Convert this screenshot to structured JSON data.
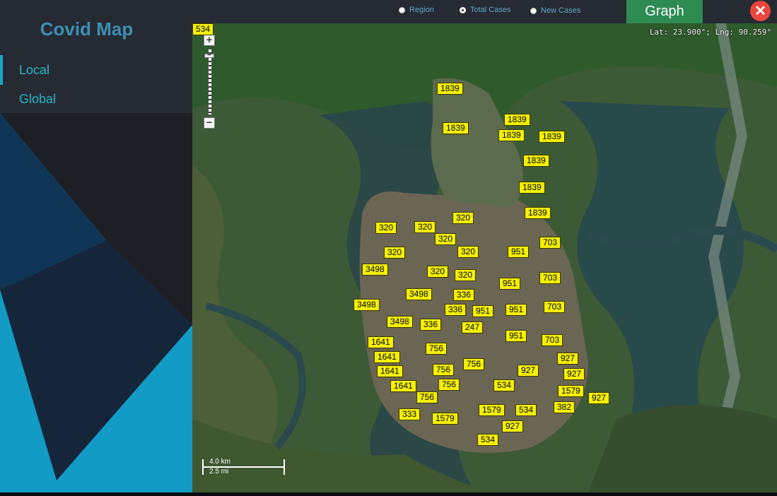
{
  "app": {
    "title": "Covid Map"
  },
  "sidebar": {
    "items": [
      {
        "label": "Local",
        "active": true
      },
      {
        "label": "Global",
        "active": false
      }
    ]
  },
  "toolbar": {
    "radio_options": [
      {
        "label": "Region",
        "selected": false
      },
      {
        "label": "Total Cases",
        "selected": true
      },
      {
        "label": "New Cases",
        "selected": false
      }
    ],
    "graph_label": "Graph",
    "close_icon": "close-icon"
  },
  "map": {
    "coords": "Lat: 23.900°; Lng: 90.259°",
    "zoom_in": "+",
    "zoom_out": "−",
    "scale_km": "4.0 km",
    "scale_mi": "2.5 mi",
    "labels": [
      "1839",
      "1839",
      "1839",
      "1839",
      "1839",
      "1839",
      "1839",
      "1839",
      "320",
      "320",
      "320",
      "320",
      "320",
      "320",
      "320",
      "320",
      "951",
      "703",
      "3498",
      "951",
      "703",
      "3498",
      "336",
      "3498",
      "336",
      "951",
      "951",
      "703",
      "3498",
      "336",
      "247",
      "951",
      "703",
      "1641",
      "756",
      "1641",
      "756",
      "756",
      "927",
      "1641",
      "756",
      "927",
      "927",
      "1641",
      "756",
      "534",
      "1579",
      "927",
      "333",
      "1579",
      "1579",
      "534",
      "382",
      "927",
      "534",
      "534"
    ]
  },
  "colors": {
    "accent": "#28b6c8",
    "graph_button": "#2e8b52",
    "close_button": "#e8463f",
    "label_bg": "#f5f000"
  }
}
